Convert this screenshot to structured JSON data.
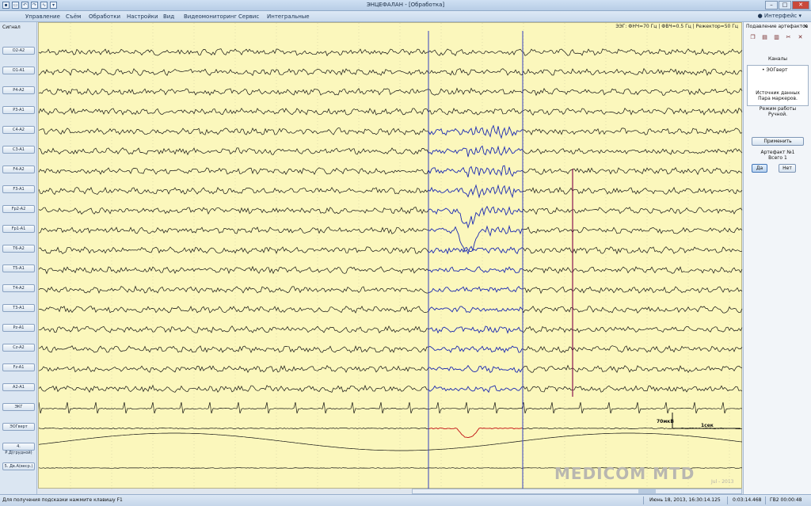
{
  "window": {
    "title": "ЭНЦЕФАЛАН - [Обработка]",
    "quick_access": [
      "save-icon",
      "print-icon",
      "undo-icon",
      "redo-icon",
      "signal-icon",
      "dropdown-icon"
    ]
  },
  "menu": {
    "items": [
      "Управление",
      "Съём",
      "Обработки",
      "Настройки",
      "Вид",
      "Видеомониторинг",
      "Сервис",
      "Интегральные"
    ],
    "user_label": "Интерфейс"
  },
  "left_panel": {
    "title": "Сигнал",
    "channels": [
      "O2-A2",
      "O1-A1",
      "P4-A2",
      "P3-A1",
      "C4-A2",
      "C3-A1",
      "F4-A2",
      "F3-A1",
      "Fp2-A2",
      "Fp1-A1",
      "T6-A2",
      "T5-A1",
      "T4-A2",
      "T3-A1",
      "Pz-A1",
      "Cz-A2",
      "Fz-A1",
      "A2-A1",
      "ЭКГ",
      "ЭОГверт",
      "4. Р.Д(грудной)",
      "5. Дв.А(веср.)"
    ]
  },
  "plot": {
    "header": "ЭЭГ: ФНЧ=70 Гц | ФВЧ=0.5 Гц | Режектор=50 Гц",
    "scale_amplitude": "70мкВ",
    "scale_time": "1сек",
    "watermark": "MEDICOM MTD",
    "watermark_date": "Jul - 2013",
    "colors": {
      "background": "#fbf7bc",
      "trace": "#111111",
      "artifact_trace": "#2232c8",
      "marker": "#3440c0",
      "eog_highlight": "#d52020",
      "cursor": "#8a1453"
    }
  },
  "right_panel": {
    "title": "Подавление артефактов",
    "tool_icons": [
      "copy-icon",
      "paste-icon",
      "delete-icon",
      "cut-icon",
      "close-icon"
    ],
    "channels_caption": "Каналы",
    "channels_list": [
      "• ЭОГверт"
    ],
    "data_source_label": "Источник данных",
    "data_source_value": "Пара маркеров.",
    "mode_label": "Режим работы",
    "mode_value": "Ручной.",
    "apply_button": "Применить",
    "artifact_label": "Артефакт №1",
    "artifact_total": "Всего 1",
    "yes_button": "Да",
    "no_button": "Нет"
  },
  "status_bar": {
    "hint": "Для получения подсказки нажмите клавишу F1",
    "date_time": "Июнь 18, 2013, 16:30:14.125",
    "position": "0:03:14.468",
    "duration": "ГВ2 00:00:48"
  }
}
